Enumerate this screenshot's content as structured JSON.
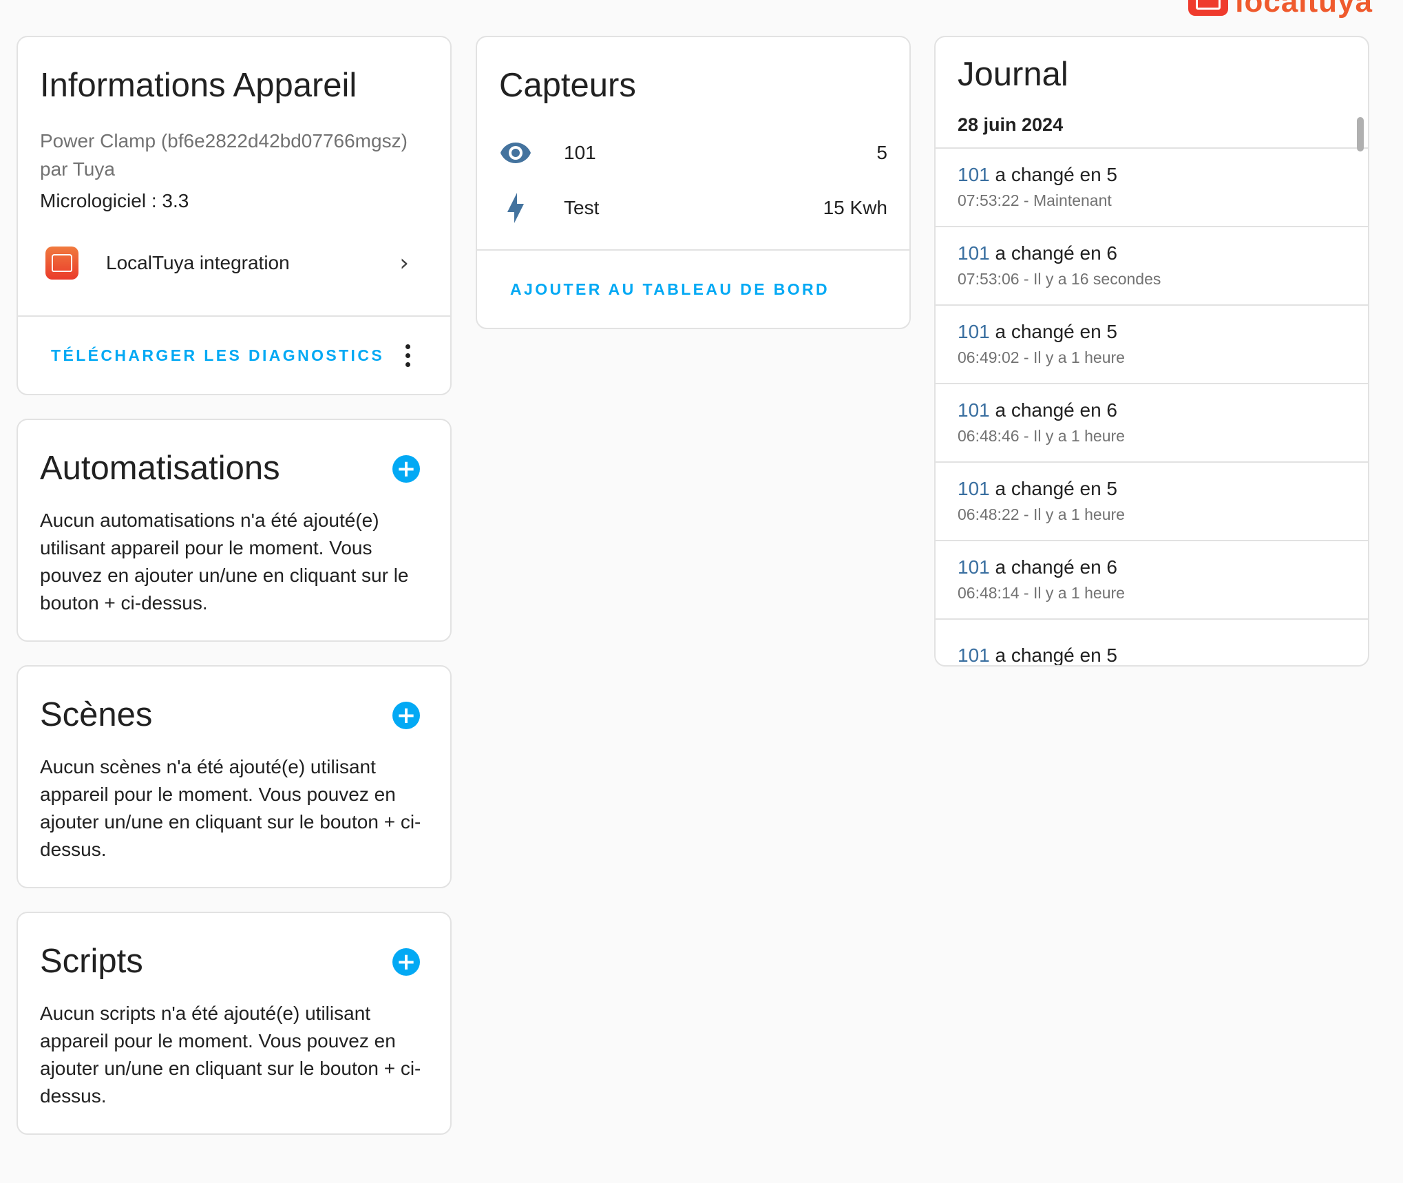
{
  "brand": {
    "name": "localtuya"
  },
  "device_info": {
    "title": "Informations Appareil",
    "model_line": "Power Clamp (bf6e2822d42bd07766mgsz)",
    "manufacturer_line": "par Tuya",
    "firmware": "Micrologiciel : 3.3",
    "integration_label": "LocalTuya integration",
    "download_diagnostics": "TÉLÉCHARGER LES DIAGNOSTICS"
  },
  "automations": {
    "title": "Automatisations",
    "empty_text": "Aucun automatisations n'a été ajouté(e) utilisant appareil pour le moment. Vous pouvez en ajouter un/une en cliquant sur le bouton + ci-dessus."
  },
  "scenes": {
    "title": "Scènes",
    "empty_text": "Aucun scènes n'a été ajouté(e) utilisant appareil pour le moment. Vous pouvez en ajouter un/une en cliquant sur le bouton + ci-dessus."
  },
  "scripts": {
    "title": "Scripts",
    "empty_text": "Aucun scripts n'a été ajouté(e) utilisant appareil pour le moment. Vous pouvez en ajouter un/une en cliquant sur le bouton + ci-dessus."
  },
  "sensors": {
    "title": "Capteurs",
    "items": [
      {
        "icon": "eye-icon",
        "name": "101",
        "value": "5"
      },
      {
        "icon": "lightning-icon",
        "name": "Test",
        "value": "15 Kwh"
      }
    ],
    "add_to_dashboard": "AJOUTER AU TABLEAU DE BORD",
    "icon_color": "#44739e"
  },
  "journal": {
    "title": "Journal",
    "date": "28 juin 2024",
    "entries": [
      {
        "entity": "101",
        "change": " a changé en 5",
        "time": "07:53:22 - Maintenant"
      },
      {
        "entity": "101",
        "change": " a changé en 6",
        "time": "07:53:06 - Il y a 16 secondes"
      },
      {
        "entity": "101",
        "change": " a changé en 5",
        "time": "06:49:02 - Il y a 1 heure"
      },
      {
        "entity": "101",
        "change": " a changé en 6",
        "time": "06:48:46 - Il y a 1 heure"
      },
      {
        "entity": "101",
        "change": " a changé en 5",
        "time": "06:48:22 - Il y a 1 heure"
      },
      {
        "entity": "101",
        "change": " a changé en 6",
        "time": "06:48:14 - Il y a 1 heure"
      },
      {
        "entity": "101",
        "change": " a changé en 5",
        "time": ""
      }
    ]
  },
  "colors": {
    "accent": "#03a9f4",
    "brand": "#ef3b2d",
    "entity_link": "#3a6fa0"
  }
}
